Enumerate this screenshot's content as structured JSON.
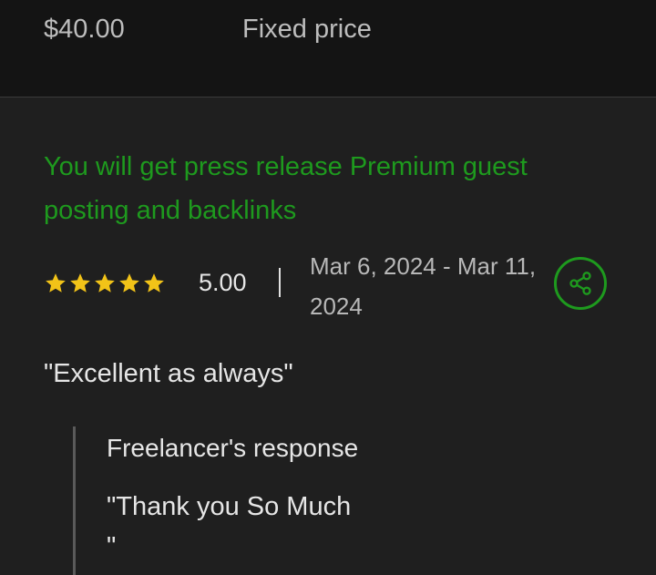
{
  "header": {
    "price": "$40.00",
    "price_type": "Fixed price"
  },
  "job": {
    "title": "You will get press release Premium guest posting and backlinks"
  },
  "rating": {
    "stars": 5,
    "score": "5.00",
    "date_range": "Mar 6, 2024 - Mar 11, 2024"
  },
  "share": {
    "icon": "share-icon"
  },
  "review": {
    "text": "\"Excellent as always\""
  },
  "response": {
    "heading": "Freelancer's response",
    "text": "\"Thank you So Much\n\""
  },
  "colors": {
    "accent": "#1e9a1e",
    "star": "#f2c318",
    "background": "#1f1f1f",
    "header_background": "#141414"
  }
}
